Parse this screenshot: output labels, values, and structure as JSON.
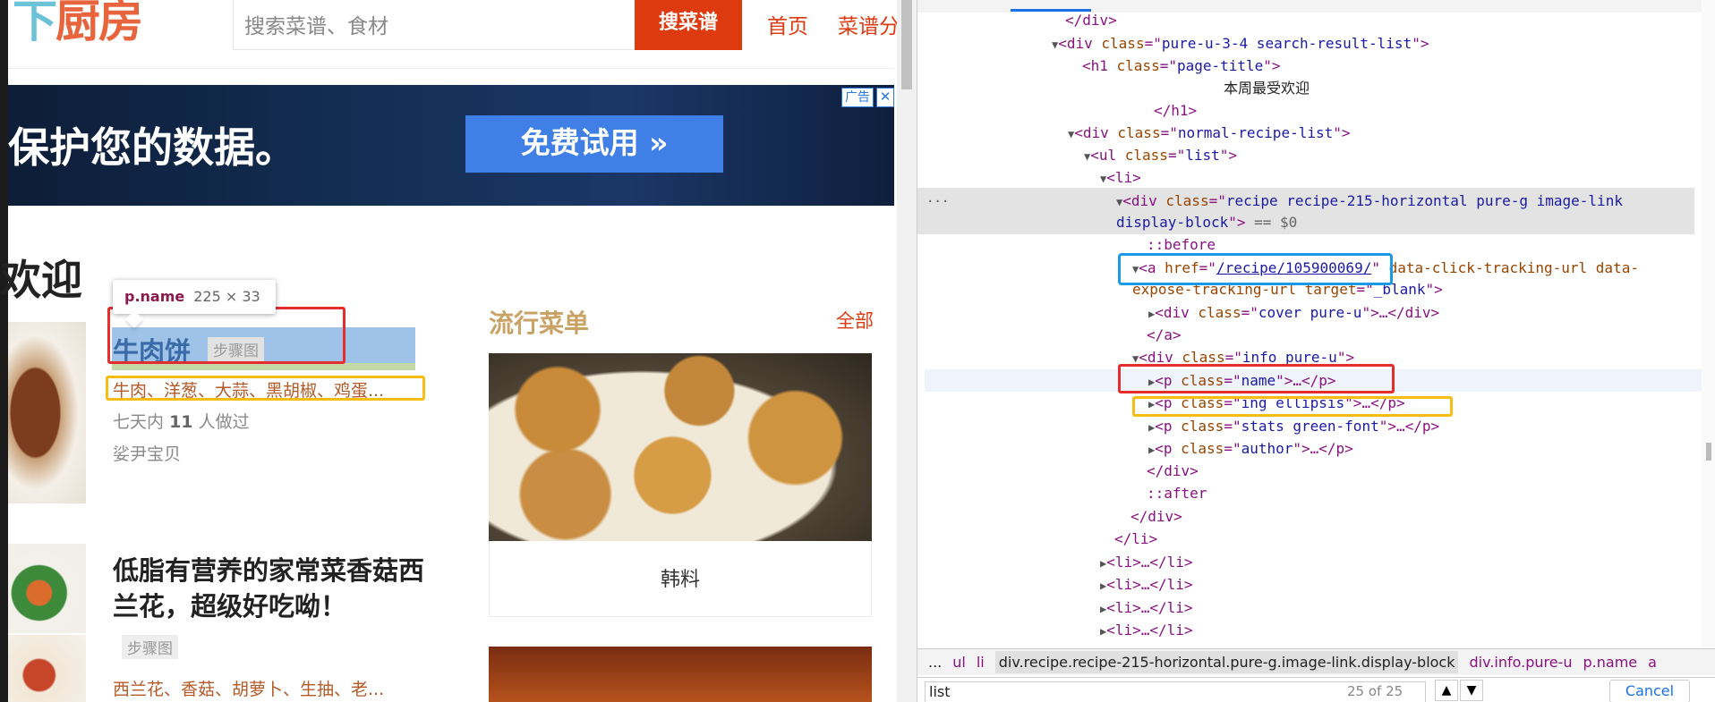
{
  "site": {
    "logo_part1": "下",
    "logo_part2": "厨房",
    "search_placeholder": "搜索菜谱、食材",
    "search_button": "搜菜谱",
    "nav": [
      "首页",
      "菜谱分"
    ]
  },
  "ad": {
    "text": "保护您的数据。",
    "button": "免费试用 »",
    "tag": "广告",
    "close": "✕"
  },
  "page_title": "欢迎",
  "tooltip": {
    "selector": "p.name",
    "size": "225 × 33"
  },
  "recipes": [
    {
      "name": "牛肉饼",
      "tag": "步骤图",
      "ingredients": "牛肉、洋葱、大蒜、黑胡椒、鸡蛋...",
      "stats_pre": "七天内",
      "stats_count": "11",
      "stats_post": "人做过",
      "author": "娑尹宝贝"
    },
    {
      "name": "低脂有营养的家常菜香菇西兰花，超级好吃呦！",
      "tag": "步骤图",
      "ingredients": "西兰花、香菇、胡萝卜、生抽、老..."
    }
  ],
  "popular": {
    "title": "流行菜单",
    "all": "全部",
    "card_caption": "韩料"
  },
  "devtools": {
    "breadcrumbs": [
      "...",
      "ul",
      "li",
      "div.recipe.recipe-215-horizontal.pure-g.image-link.display-block",
      "div.info.pure-u",
      "p.name",
      "a"
    ],
    "find_query": "list",
    "find_count": "25 of 25",
    "find_cancel": "Cancel",
    "dots": "...",
    "eq": "== $0"
  },
  "colors": {
    "accent": "#dd3a10",
    "logo_blue": "#6cc3d8",
    "logo_orange": "#e8643c",
    "highlight_red": "#e52d2d",
    "highlight_yellow": "#f7bd12",
    "highlight_blue": "#1a9ae6"
  }
}
